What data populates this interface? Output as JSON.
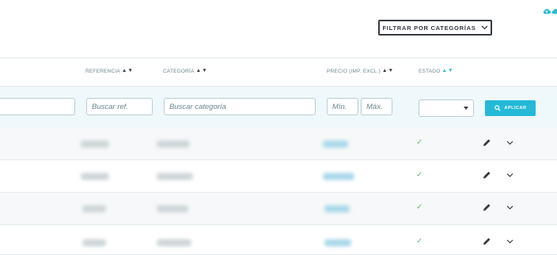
{
  "toolbar": {
    "filter_label": "FILTRAR POR CATEGORÍAS",
    "icons": [
      "cloud-upload-icon",
      "cloud-download-icon"
    ],
    "accent_color": "#25b9d7"
  },
  "table": {
    "columns": [
      {
        "key": "reference",
        "label": "Referencia",
        "sort": "none"
      },
      {
        "key": "category",
        "label": "Categoría",
        "sort": "none"
      },
      {
        "key": "price",
        "label": "Precio (imp. excl.)",
        "sort": "none"
      },
      {
        "key": "status",
        "label": "Estado",
        "sort": "active"
      }
    ],
    "filters": {
      "name_placeholder": "",
      "reference_placeholder": "Buscar ref.",
      "category_placeholder": "Buscar categoría",
      "price_min_placeholder": "Mín.",
      "price_max_placeholder": "Máx.",
      "status_value": "",
      "apply_label": "APLICAR"
    },
    "rows": [
      {
        "status": "✓"
      },
      {
        "status": "✓"
      },
      {
        "status": "✓"
      },
      {
        "status": "✓"
      }
    ]
  }
}
